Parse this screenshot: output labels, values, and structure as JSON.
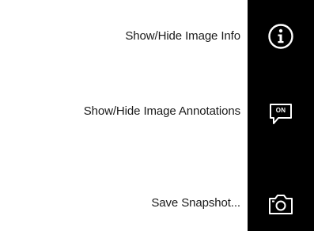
{
  "menu": {
    "items": [
      {
        "label": "Show/Hide Image Info",
        "icon": "info-icon"
      },
      {
        "label": "Show/Hide Image Annotations",
        "icon": "annotations-on-icon",
        "icon_text": "ON"
      },
      {
        "label": "Save Snapshot...",
        "icon": "camera-icon"
      }
    ]
  },
  "colors": {
    "toolbar_bg": "#000000",
    "icon": "#ffffff",
    "label": "#1a1a1a",
    "background": "#ffffff"
  }
}
